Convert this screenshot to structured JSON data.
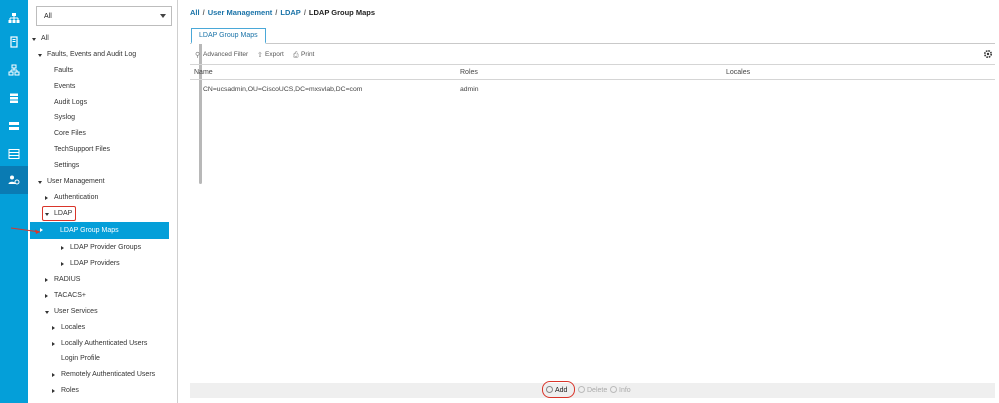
{
  "rail": {
    "items": [
      {
        "icon": "network-icon"
      },
      {
        "icon": "server-icon"
      },
      {
        "icon": "topology-icon"
      },
      {
        "icon": "storage-icon"
      },
      {
        "icon": "lan-icon"
      },
      {
        "icon": "list-icon"
      },
      {
        "icon": "admin-icon",
        "active": true
      }
    ]
  },
  "nav": {
    "filter_value": "All",
    "tree": {
      "all": "All",
      "faults": "Faults, Events and Audit Log",
      "faults_item": "Faults",
      "events": "Events",
      "audit_logs": "Audit Logs",
      "syslog": "Syslog",
      "core_files": "Core Files",
      "techsupport": "TechSupport Files",
      "settings": "Settings",
      "user_management": "User Management",
      "authentication": "Authentication",
      "ldap": "LDAP",
      "ldap_group_maps": "LDAP Group Maps",
      "ldap_provider_groups": "LDAP Provider Groups",
      "ldap_providers": "LDAP Providers",
      "radius": "RADIUS",
      "tacacs": "TACACS+",
      "user_services": "User Services",
      "locales": "Locales",
      "locally_auth": "Locally Authenticated Users",
      "login_profile": "Login Profile",
      "remotely_auth": "Remotely Authenticated Users",
      "roles": "Roles"
    }
  },
  "breadcrumb": {
    "all": "All",
    "sep": "/",
    "user_management": "User Management",
    "ldap": "LDAP",
    "current": "LDAP Group Maps"
  },
  "main": {
    "tab": "LDAP Group Maps",
    "toolbar": {
      "advanced_filter": "Advanced Filter",
      "export": "Export",
      "print": "Print"
    },
    "columns": {
      "name": "Name",
      "roles": "Roles",
      "locales": "Locales"
    },
    "rows": [
      {
        "name": "CN=ucsadmin,OU=CiscoUCS,DC=mxsvlab,DC=com",
        "roles": "admin",
        "locales": ""
      }
    ],
    "footer": {
      "add": "Add",
      "delete": "Delete",
      "info": "Info"
    }
  },
  "colors": {
    "accent": "#049fd9",
    "highlight": "#d9352a"
  }
}
